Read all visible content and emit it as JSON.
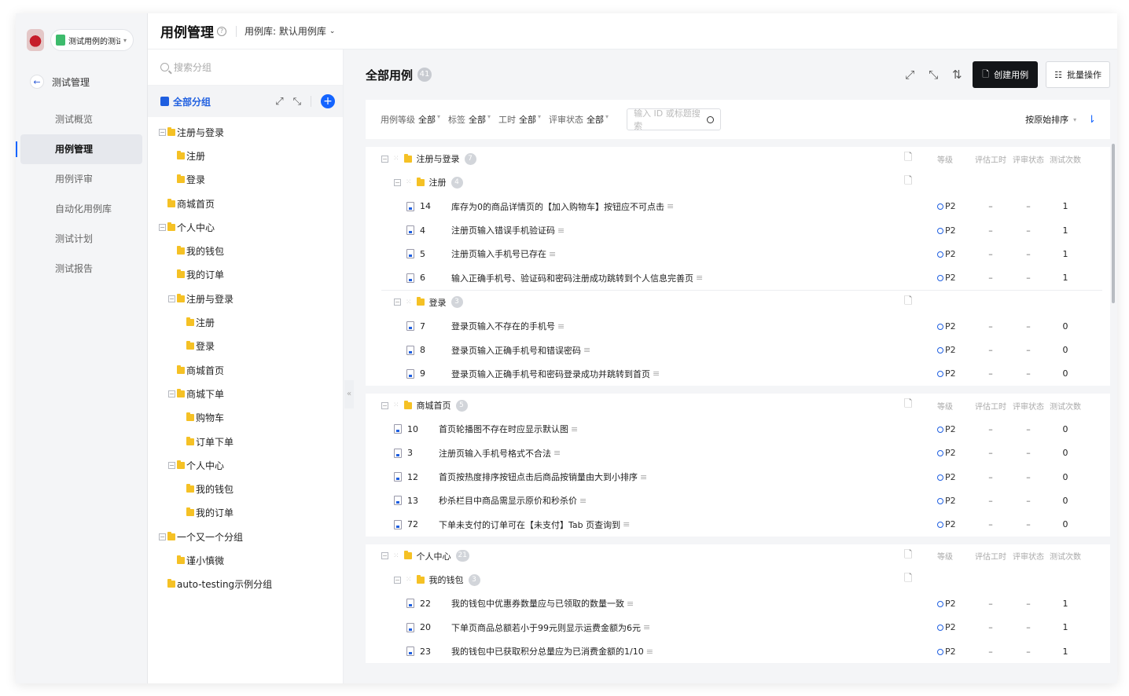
{
  "project": {
    "name": "测试用例的测试..."
  },
  "nav": {
    "back_label": "测试管理",
    "items": [
      {
        "label": "测试概览",
        "active": false
      },
      {
        "label": "用例管理",
        "active": true
      },
      {
        "label": "用例评审",
        "active": false
      },
      {
        "label": "自动化用例库",
        "active": false
      },
      {
        "label": "测试计划",
        "active": false
      },
      {
        "label": "测试报告",
        "active": false
      }
    ]
  },
  "header": {
    "title": "用例管理",
    "library_label": "用例库: 默认用例库"
  },
  "tree": {
    "search_placeholder": "搜索分组",
    "all_label": "全部分组",
    "nodes": [
      {
        "label": "注册与登录",
        "collapsible": true
      },
      {
        "label": "注册",
        "collapsible": false
      },
      {
        "label": "登录",
        "collapsible": false
      },
      {
        "label": "商城首页",
        "collapsible": false
      },
      {
        "label": "个人中心",
        "collapsible": true
      },
      {
        "label": "我的钱包",
        "collapsible": false
      },
      {
        "label": "我的订单",
        "collapsible": false
      },
      {
        "label": "注册与登录",
        "collapsible": true
      },
      {
        "label": "注册",
        "collapsible": false
      },
      {
        "label": "登录",
        "collapsible": false
      },
      {
        "label": "商城首页",
        "collapsible": false
      },
      {
        "label": "商城下单",
        "collapsible": true
      },
      {
        "label": "购物车",
        "collapsible": false
      },
      {
        "label": "订单下单",
        "collapsible": false
      },
      {
        "label": "个人中心",
        "collapsible": true
      },
      {
        "label": "我的钱包",
        "collapsible": false
      },
      {
        "label": "我的订单",
        "collapsible": false
      },
      {
        "label": "一个又一个分组",
        "collapsible": true
      },
      {
        "label": "谨小慎微",
        "collapsible": false
      },
      {
        "label": "auto-testing示例分组",
        "collapsible": false
      }
    ]
  },
  "main": {
    "title": "全部用例",
    "count": "41",
    "create_label": "创建用例",
    "batch_label": "批量操作",
    "sort_label": "按原始排序",
    "filters": [
      {
        "label": "用例等级",
        "value": "全部"
      },
      {
        "label": "标签",
        "value": "全部"
      },
      {
        "label": "工时",
        "value": "全部"
      },
      {
        "label": "评审状态",
        "value": "全部"
      }
    ],
    "search_placeholder": "输入 ID 或标题搜索",
    "columns": {
      "level": "等级",
      "estimate": "评估工时",
      "review": "评审状态",
      "runs": "测试次数"
    },
    "level_value": "P2",
    "dash": "–",
    "sections": [
      {
        "name": "注册与登录",
        "count": "7",
        "subgroups": [
          {
            "name": "注册",
            "count": "4",
            "cases": [
              {
                "id": "14",
                "title": "库存为0的商品详情页的【加入购物车】按钮应不可点击",
                "runs": "1"
              },
              {
                "id": "4",
                "title": "注册页输入错误手机验证码",
                "runs": "1"
              },
              {
                "id": "5",
                "title": "注册页输入手机号已存在",
                "runs": "1"
              },
              {
                "id": "6",
                "title": "输入正确手机号、验证码和密码注册成功跳转到个人信息完善页",
                "runs": "1"
              }
            ]
          },
          {
            "name": "登录",
            "count": "3",
            "cases": [
              {
                "id": "7",
                "title": "登录页输入不存在的手机号",
                "runs": "0"
              },
              {
                "id": "8",
                "title": "登录页输入正确手机号和错误密码",
                "runs": "0"
              },
              {
                "id": "9",
                "title": "登录页输入正确手机号和密码登录成功并跳转到首页",
                "runs": "0"
              }
            ]
          }
        ]
      },
      {
        "name": "商城首页",
        "count": "5",
        "cases": [
          {
            "id": "10",
            "title": "首页轮播图不存在时应显示默认图",
            "runs": "0"
          },
          {
            "id": "3",
            "title": "注册页输入手机号格式不合法",
            "runs": "0"
          },
          {
            "id": "12",
            "title": "首页按热度排序按钮点击后商品按销量由大到小排序",
            "runs": "0"
          },
          {
            "id": "13",
            "title": "秒杀栏目中商品需显示原价和秒杀价",
            "runs": "0"
          },
          {
            "id": "72",
            "title": "下单未支付的订单可在【未支付】Tab 页查询到",
            "runs": "0"
          }
        ]
      },
      {
        "name": "个人中心",
        "count": "21",
        "subgroups": [
          {
            "name": "我的钱包",
            "count": "3",
            "cases": [
              {
                "id": "22",
                "title": "我的钱包中优惠券数量应与已领取的数量一致",
                "runs": "1"
              },
              {
                "id": "20",
                "title": "下单页商品总额若小于99元则显示运费金额为6元",
                "runs": "1"
              },
              {
                "id": "23",
                "title": "我的钱包中已获取积分总量应为已消费金额的1/10",
                "runs": "1"
              }
            ]
          }
        ]
      }
    ]
  }
}
